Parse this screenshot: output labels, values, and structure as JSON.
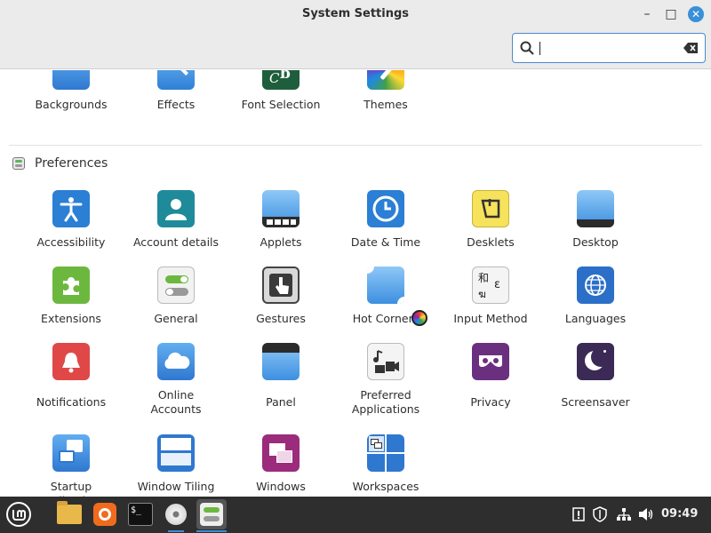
{
  "window": {
    "title": "System Settings",
    "controls": {
      "minimize": "–",
      "maximize": "□",
      "close": "✕"
    }
  },
  "search": {
    "value": "",
    "placeholder": ""
  },
  "appearance": {
    "items": [
      {
        "label": "Backgrounds",
        "icon": "backgrounds-icon"
      },
      {
        "label": "Effects",
        "icon": "effects-icon"
      },
      {
        "label": "Font Selection",
        "icon": "font-selection-icon"
      },
      {
        "label": "Themes",
        "icon": "themes-icon"
      }
    ]
  },
  "preferences": {
    "title": "Preferences",
    "items": [
      {
        "label": "Accessibility",
        "icon": "accessibility-icon"
      },
      {
        "label": "Account details",
        "icon": "account-details-icon"
      },
      {
        "label": "Applets",
        "icon": "applets-icon"
      },
      {
        "label": "Date & Time",
        "icon": "clock-icon"
      },
      {
        "label": "Desklets",
        "icon": "desklets-icon"
      },
      {
        "label": "Desktop",
        "icon": "desktop-icon"
      },
      {
        "label": "Extensions",
        "icon": "puzzle-icon"
      },
      {
        "label": "General",
        "icon": "toggles-icon"
      },
      {
        "label": "Gestures",
        "icon": "gesture-hand-icon"
      },
      {
        "label": "Hot Corners",
        "icon": "hot-corners-icon"
      },
      {
        "label": "Input Method",
        "icon": "input-method-icon"
      },
      {
        "label": "Languages",
        "icon": "globe-icon"
      },
      {
        "label": "Notifications",
        "icon": "bell-icon"
      },
      {
        "label": "Online Accounts",
        "icon": "cloud-icon"
      },
      {
        "label": "Panel",
        "icon": "panel-icon"
      },
      {
        "label": "Preferred Applications",
        "icon": "preferred-apps-icon"
      },
      {
        "label": "Privacy",
        "icon": "mask-icon"
      },
      {
        "label": "Screensaver",
        "icon": "moon-icon"
      },
      {
        "label": "Startup Applications",
        "icon": "startup-icon"
      },
      {
        "label": "Window Tiling",
        "icon": "window-tiling-icon"
      },
      {
        "label": "Windows",
        "icon": "windows-icon"
      },
      {
        "label": "Workspaces",
        "icon": "workspaces-icon"
      }
    ]
  },
  "input_method_glyphs": {
    "top": "和",
    "bottom": "ฆ",
    "right": "ε"
  },
  "font_icon_glyphs": {
    "a": "a",
    "b": "b",
    "c": "C"
  },
  "taskbar": {
    "clock": "09:49",
    "launchers": [
      {
        "name": "menu-button",
        "icon": "mint-logo-icon"
      },
      {
        "name": "files-launcher",
        "icon": "folder-icon"
      },
      {
        "name": "firefox-launcher",
        "icon": "firefox-icon"
      },
      {
        "name": "terminal-launcher",
        "icon": "terminal-icon"
      },
      {
        "name": "disc-launcher",
        "icon": "disc-icon"
      },
      {
        "name": "system-settings-task",
        "icon": "toggles-icon"
      }
    ],
    "terminal_glyph": "$_"
  },
  "colors": {
    "accent": "#3a8fd8",
    "titlebar": "#ebebeb",
    "taskbar": "#2e2e2e"
  }
}
